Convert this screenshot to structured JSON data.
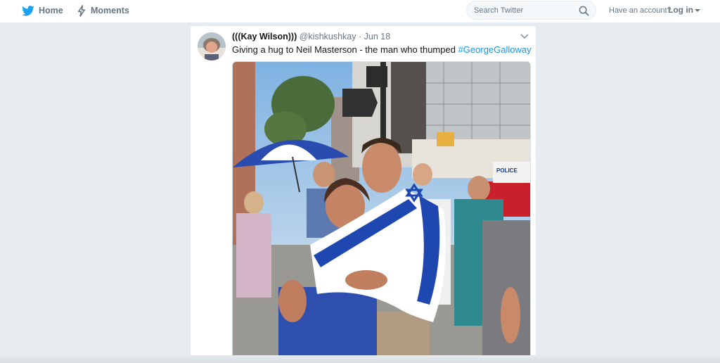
{
  "nav": {
    "home_label": "Home",
    "home_icon": "twitter-bird-icon",
    "moments_label": "Moments",
    "moments_icon": "lightning-icon",
    "search_placeholder": "Search Twitter",
    "search_icon": "search-icon",
    "have_account": "Have an account?",
    "login_label": "Log in"
  },
  "tweet": {
    "display_name": "(((Kay Wilson)))",
    "handle": "@kishkushkay",
    "separator": "·",
    "date": "Jun 18",
    "text": "Giving a hug to Neil Masterson - the man who thumped ",
    "hashtag": "#GeorgeGalloway",
    "menu_icon": "chevron-down-icon"
  },
  "photo_signs": {
    "police": "POLICE"
  },
  "colors": {
    "brand_blue": "#1da1f2",
    "link_blue": "#1b95e0",
    "background": "#e6ecf0",
    "text_muted": "#657786"
  }
}
